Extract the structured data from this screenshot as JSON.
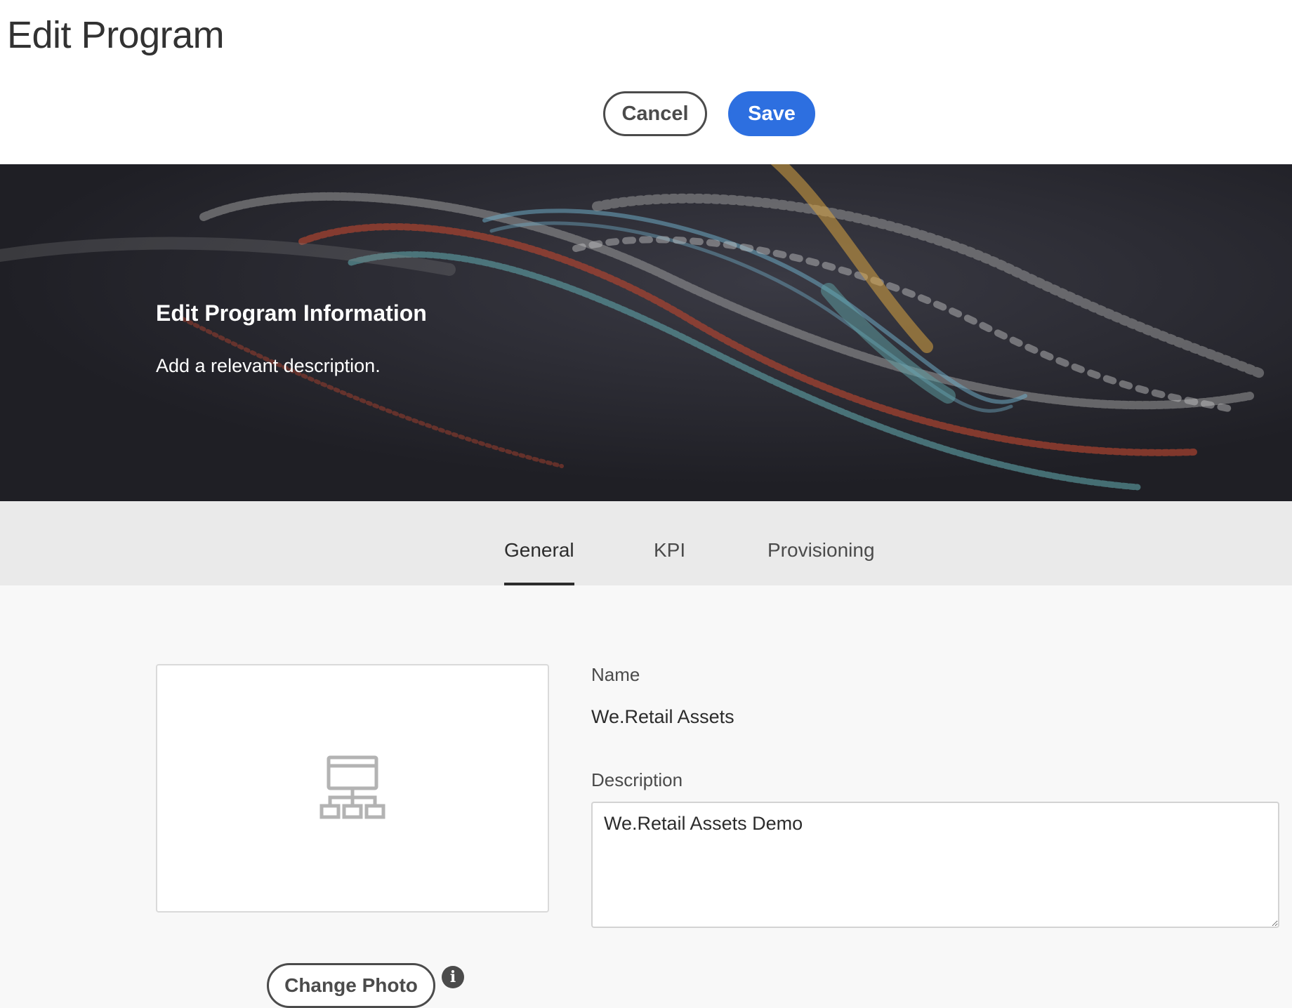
{
  "header": {
    "title": "Edit Program",
    "cancel_label": "Cancel",
    "save_label": "Save"
  },
  "hero": {
    "title": "Edit Program Information",
    "description": "Add a relevant description."
  },
  "tabs": [
    {
      "label": "General",
      "active": true
    },
    {
      "label": "KPI",
      "active": false
    },
    {
      "label": "Provisioning",
      "active": false
    }
  ],
  "form": {
    "photo": {
      "placeholder_icon": "site-structure-icon",
      "change_label": "Change Photo",
      "info_icon": "info-icon"
    },
    "name_label": "Name",
    "name_value": "We.Retail Assets",
    "description_label": "Description",
    "description_value": "We.Retail Assets Demo"
  },
  "colors": {
    "accent": "#2d6fe0",
    "hero_background": "#26262c",
    "tabbar_background": "#eaeaea",
    "content_background": "#f8f8f8"
  }
}
